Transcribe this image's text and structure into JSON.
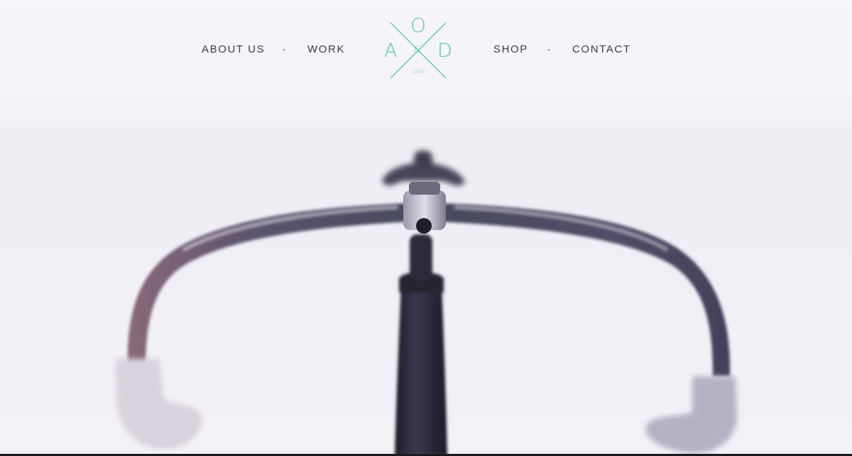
{
  "nav": {
    "left_links": [
      {
        "label": "ABOUT US"
      },
      {
        "label": "WORK"
      }
    ],
    "right_links": [
      {
        "label": "SHOP"
      },
      {
        "label": "CONTACT"
      }
    ],
    "separator": "."
  },
  "logo": {
    "top_letter": "O",
    "left_letter": "A",
    "right_letter": "D",
    "ampersand": "&",
    "caption": "100%",
    "color": "#5ec4a0"
  },
  "hero": {
    "image_subject": "bicycle-handlebar"
  }
}
